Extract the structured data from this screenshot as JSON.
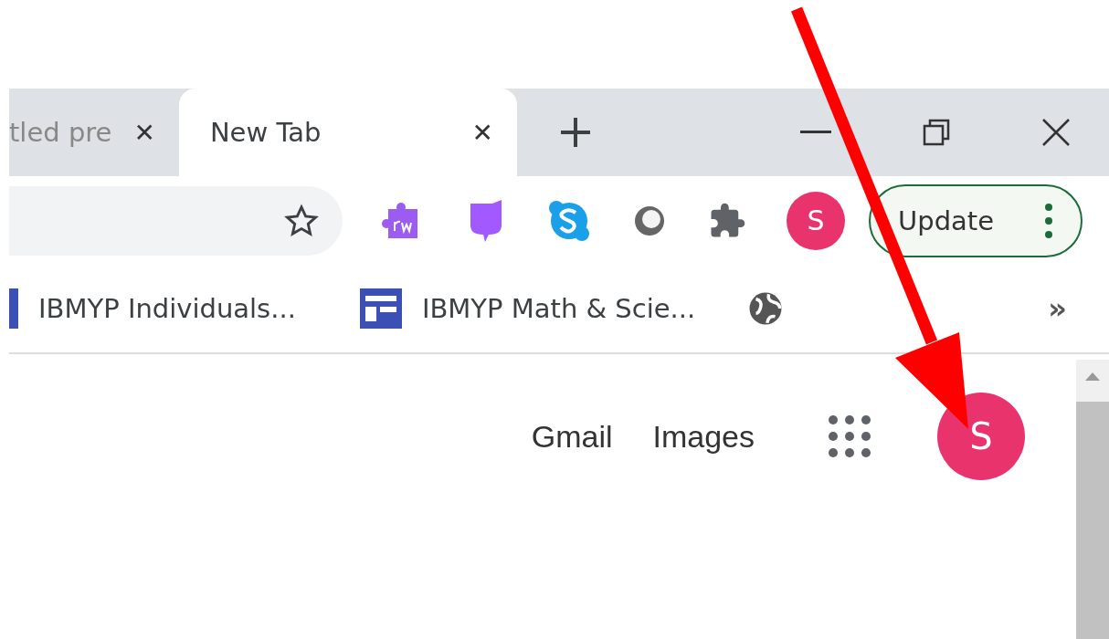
{
  "tabs": [
    {
      "label": "tled pre",
      "selected": false,
      "close": "✕"
    },
    {
      "label": "New Tab",
      "selected": true,
      "close": "✕"
    }
  ],
  "toolbar": {
    "profile_initial": "S",
    "update_button": "Update"
  },
  "bookmarks": [
    {
      "label": "IBMYP Individuals...",
      "kind": "bar"
    },
    {
      "label": "IBMYP Math & Scie...",
      "kind": "layout"
    },
    {
      "kind": "globe"
    }
  ],
  "bookmarks_overflow": "»",
  "page": {
    "links": [
      "Gmail",
      "Images"
    ],
    "avatar_initial": "S"
  }
}
